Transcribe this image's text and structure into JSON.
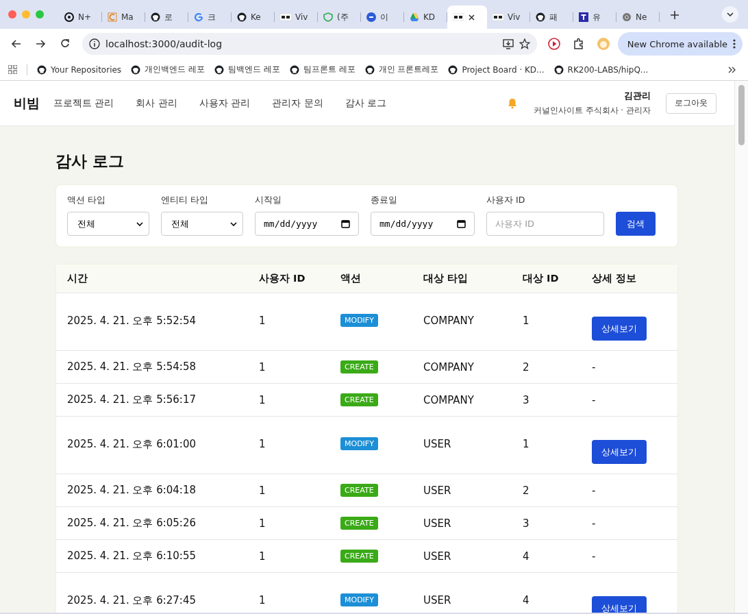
{
  "browser": {
    "tabs": [
      {
        "title": "N+",
        "selected": false
      },
      {
        "title": "Ma",
        "selected": false
      },
      {
        "title": "로",
        "selected": false
      },
      {
        "title": "크",
        "selected": false
      },
      {
        "title": "Ke",
        "selected": false
      },
      {
        "title": "Viv",
        "selected": false
      },
      {
        "title": "(주",
        "selected": false
      },
      {
        "title": "이",
        "selected": false
      },
      {
        "title": "KD",
        "selected": false
      },
      {
        "selected": true
      },
      {
        "title": "Viv",
        "selected": false
      },
      {
        "title": "패",
        "selected": false
      },
      {
        "title": "유",
        "selected": false
      },
      {
        "title": "Ne",
        "selected": false
      }
    ],
    "url": "localhost:3000/audit-log",
    "update_label": "New Chrome available",
    "bookmarks": [
      "Your Repositories",
      "개인백엔드 레포",
      "팀백엔드 레포",
      "팀프론트 레포",
      "개인 프론트레포",
      "Project Board · KD...",
      "RK200-LABS/hipQ..."
    ]
  },
  "header": {
    "logo": "비빔",
    "nav": [
      {
        "label": "프로젝트 관리",
        "selected": false
      },
      {
        "label": "회사 관리",
        "selected": false
      },
      {
        "label": "사용자 관리",
        "selected": false
      },
      {
        "label": "관리자 문의",
        "selected": false
      },
      {
        "label": "감사 로그",
        "selected": false
      }
    ],
    "user_name": "김관리",
    "user_org": "커널인사이트 주식회사 · 관리자",
    "logout": "로그아웃"
  },
  "page_title": "감사 로그",
  "filters": {
    "fields": [
      {
        "kind": "select",
        "label": "액션 타입",
        "value": "전체"
      },
      {
        "kind": "select",
        "label": "엔티티 타입",
        "value": "전체"
      },
      {
        "kind": "date",
        "label": "시작일",
        "placeholder": "mm/dd/yyyy"
      },
      {
        "kind": "date",
        "label": "종료일",
        "placeholder": "mm/dd/yyyy"
      },
      {
        "kind": "text",
        "label": "사용자 ID",
        "placeholder": "사용자 ID"
      }
    ],
    "search_button": "검색"
  },
  "table": {
    "columns": [
      "시간",
      "사용자 ID",
      "액션",
      "대상 타입",
      "대상 ID",
      "상세 정보"
    ],
    "rows": [
      {
        "time": "2025. 4. 21. 오후 5:52:54",
        "user_id": "1",
        "action": "MODIFY",
        "target_type": "COMPANY",
        "target_id": "1",
        "detail": {
          "kind": "button",
          "label": "상세보기"
        }
      },
      {
        "time": "2025. 4. 21. 오후 5:54:58",
        "user_id": "1",
        "action": "CREATE",
        "target_type": "COMPANY",
        "target_id": "2",
        "detail": {
          "kind": "text",
          "label": "-"
        }
      },
      {
        "time": "2025. 4. 21. 오후 5:56:17",
        "user_id": "1",
        "action": "CREATE",
        "target_type": "COMPANY",
        "target_id": "3",
        "detail": {
          "kind": "text",
          "label": "-"
        }
      },
      {
        "time": "2025. 4. 21. 오후 6:01:00",
        "user_id": "1",
        "action": "MODIFY",
        "target_type": "USER",
        "target_id": "1",
        "detail": {
          "kind": "button",
          "label": "상세보기"
        }
      },
      {
        "time": "2025. 4. 21. 오후 6:04:18",
        "user_id": "1",
        "action": "CREATE",
        "target_type": "USER",
        "target_id": "2",
        "detail": {
          "kind": "text",
          "label": "-"
        }
      },
      {
        "time": "2025. 4. 21. 오후 6:05:26",
        "user_id": "1",
        "action": "CREATE",
        "target_type": "USER",
        "target_id": "3",
        "detail": {
          "kind": "text",
          "label": "-"
        }
      },
      {
        "time": "2025. 4. 21. 오후 6:10:55",
        "user_id": "1",
        "action": "CREATE",
        "target_type": "USER",
        "target_id": "4",
        "detail": {
          "kind": "text",
          "label": "-"
        }
      },
      {
        "time": "2025. 4. 21. 오후 6:27:45",
        "user_id": "1",
        "action": "MODIFY",
        "target_type": "USER",
        "target_id": "4",
        "detail": {
          "kind": "button",
          "label": "상세보기"
        }
      }
    ]
  }
}
